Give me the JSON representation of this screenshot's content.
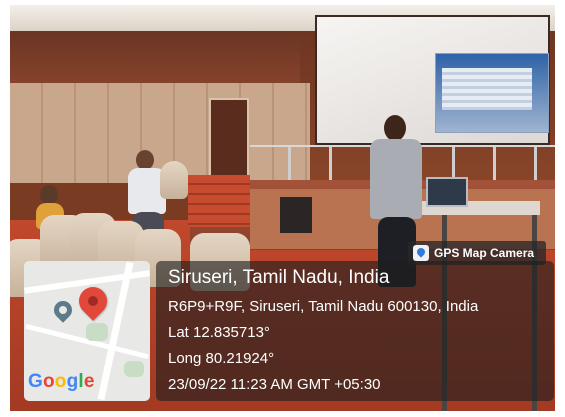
{
  "badge": {
    "label": "GPS Map Camera",
    "icon": "map-pin-camera-icon"
  },
  "location": {
    "title": "Siruseri, Tamil Nadu, India",
    "address": "R6P9+R9F, Siruseri, Tamil Nadu 600130, India",
    "latitude": "Lat 12.835713°",
    "longitude": "Long 80.21924°",
    "datetime": "23/09/22 11:23 AM GMT +05:30"
  },
  "map": {
    "logo": "Google",
    "pin_color": "#e2483a",
    "logo_colors": [
      "#4285f4",
      "#ea4335",
      "#fbbc05",
      "#4285f4",
      "#34a853",
      "#ea4335"
    ]
  }
}
